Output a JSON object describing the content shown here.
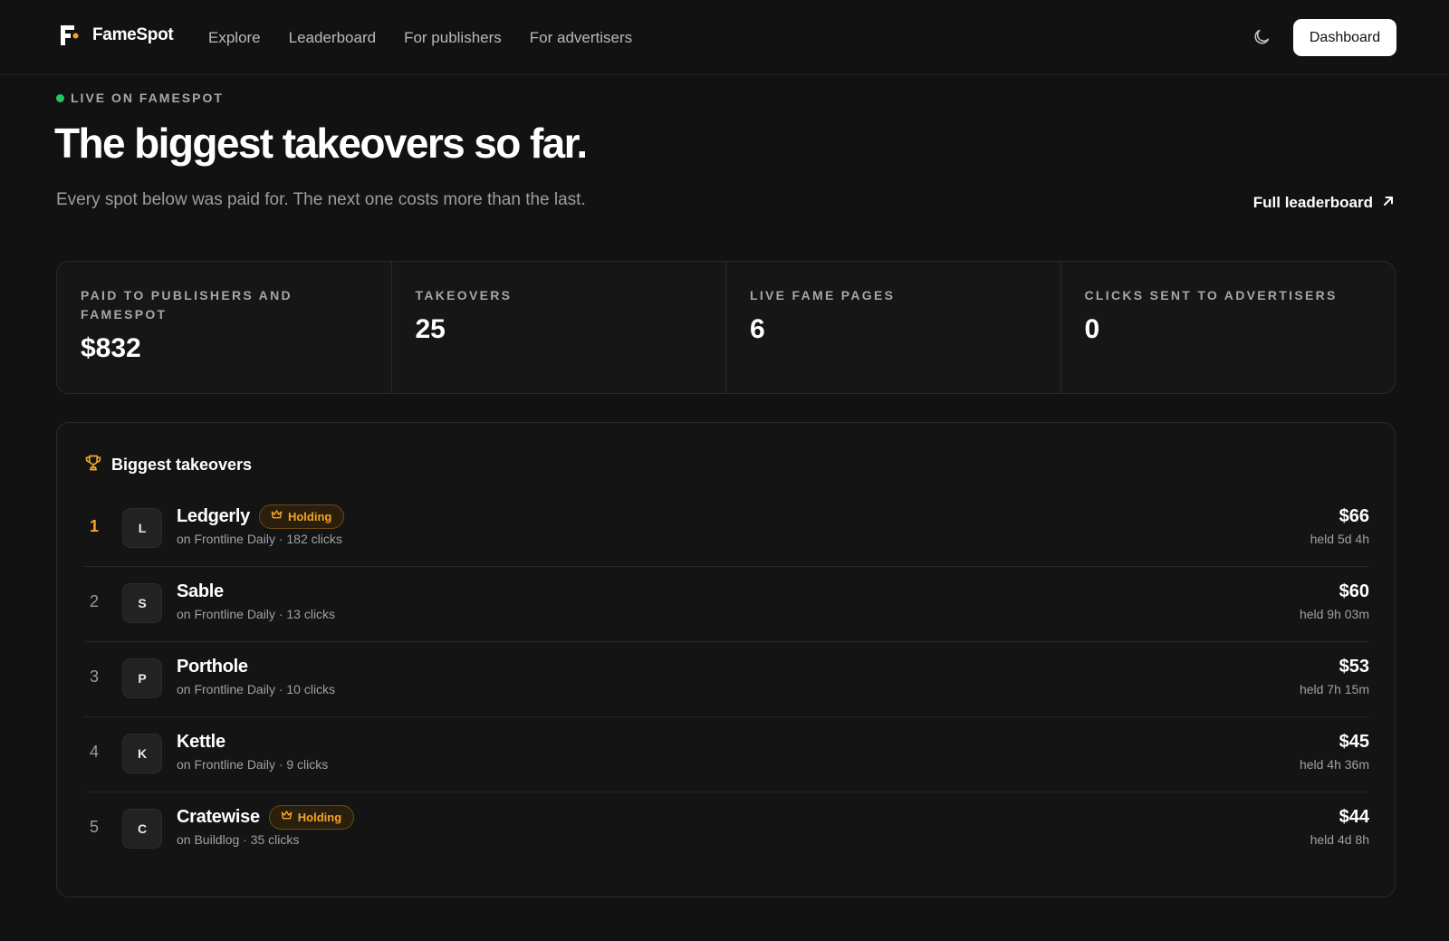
{
  "nav": {
    "brand": "FameSpot",
    "links": [
      "Explore",
      "Leaderboard",
      "For publishers",
      "For advertisers"
    ],
    "dashboard_label": "Dashboard",
    "theme_icon": "moon-icon"
  },
  "hero": {
    "live_label": "LIVE ON FAMESPOT",
    "title": "The biggest takeovers so far.",
    "subtitle": "Every spot below was paid for. The next one costs more than the last.",
    "full_leaderboard_label": "Full leaderboard"
  },
  "stats": [
    {
      "label": "PAID TO PUBLISHERS AND FAMESPOT",
      "value": "$832"
    },
    {
      "label": "TAKEOVERS",
      "value": "25"
    },
    {
      "label": "LIVE FAME PAGES",
      "value": "6"
    },
    {
      "label": "CLICKS SENT TO ADVERTISERS",
      "value": "0"
    }
  ],
  "takeovers": {
    "title": "Biggest takeovers",
    "holding_label": "Holding",
    "rows": [
      {
        "rank": "1",
        "initial": "L",
        "name": "Ledgerly",
        "holding": true,
        "sub": "on Frontline Daily · 182 clicks",
        "amount": "$66",
        "held": "held 5d 4h"
      },
      {
        "rank": "2",
        "initial": "S",
        "name": "Sable",
        "holding": false,
        "sub": "on Frontline Daily · 13 clicks",
        "amount": "$60",
        "held": "held 9h 03m"
      },
      {
        "rank": "3",
        "initial": "P",
        "name": "Porthole",
        "holding": false,
        "sub": "on Frontline Daily · 10 clicks",
        "amount": "$53",
        "held": "held 7h 15m"
      },
      {
        "rank": "4",
        "initial": "K",
        "name": "Kettle",
        "holding": false,
        "sub": "on Frontline Daily · 9 clicks",
        "amount": "$45",
        "held": "held 4h 36m"
      },
      {
        "rank": "5",
        "initial": "C",
        "name": "Cratewise",
        "holding": true,
        "sub": "on Buildlog · 35 clicks",
        "amount": "$44",
        "held": "held 4d 8h"
      }
    ]
  },
  "colors": {
    "background": "#121212",
    "accent": "#f5a524",
    "live": "#22c55e"
  }
}
